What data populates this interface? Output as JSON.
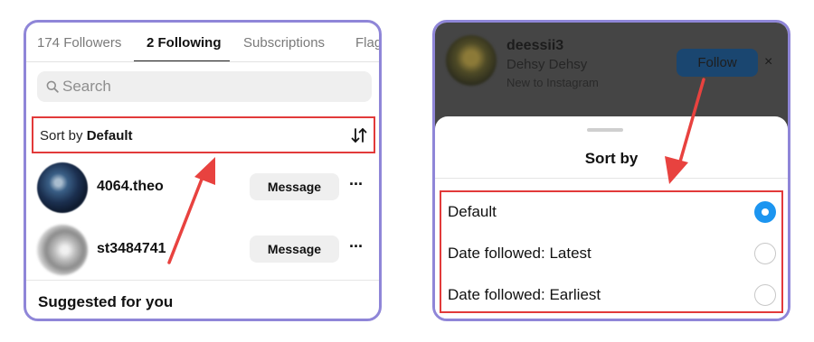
{
  "left_panel": {
    "tabs": [
      {
        "label": "174 Followers"
      },
      {
        "label": "2 Following"
      },
      {
        "label": "Subscriptions"
      },
      {
        "label": "Flag"
      }
    ],
    "search": {
      "placeholder": "Search"
    },
    "sort": {
      "prefix": "Sort by",
      "value": "Default"
    },
    "users": [
      {
        "username": "4064.theo",
        "message_label": "Message",
        "more_label": "···"
      },
      {
        "username": "st3484741",
        "message_label": "Message",
        "more_label": "···"
      }
    ],
    "suggested_heading": "Suggested for you"
  },
  "right_panel": {
    "profile": {
      "username": "deessii3",
      "name": "Dehsy Dehsy",
      "subtitle": "New to Instagram",
      "follow_label": "Follow",
      "close_label": "×"
    },
    "sheet": {
      "title": "Sort by",
      "options": [
        {
          "label": "Default",
          "selected": true
        },
        {
          "label": "Date followed: Latest",
          "selected": false
        },
        {
          "label": "Date followed: Earliest",
          "selected": false
        }
      ]
    }
  },
  "colors": {
    "panel_border": "#8f86d8",
    "highlight": "#e23a3a",
    "radio_selected": "#1c95f0",
    "dim_overlay": "#454545"
  },
  "icons": [
    "search-icon",
    "sort-arrows-icon",
    "more-icon",
    "close-icon",
    "radio-icon",
    "annotation-arrow"
  ]
}
